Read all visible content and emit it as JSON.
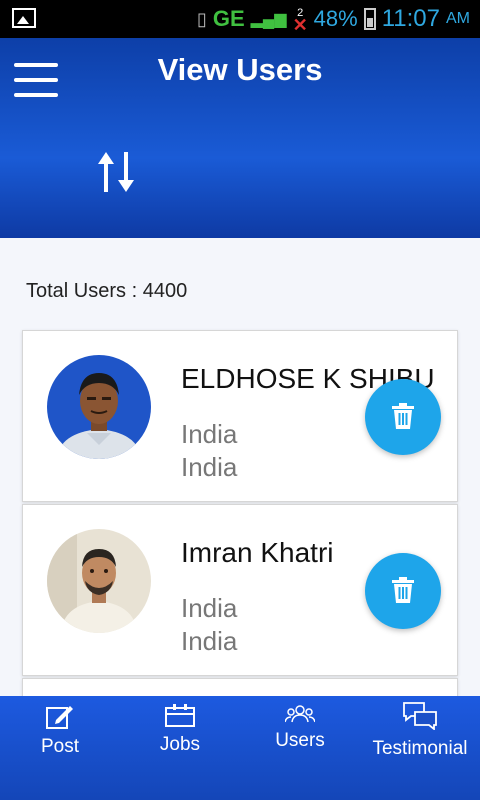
{
  "status": {
    "network": "GE",
    "sim": "2",
    "battery": "48%",
    "time": "11:07",
    "ampm": "AM"
  },
  "header": {
    "title": "View Users"
  },
  "content": {
    "total_label": "Total Users : 4400",
    "users": [
      {
        "name": "ELDHOSE K SHIBU",
        "line1": "India",
        "line2": "India"
      },
      {
        "name": "Imran Khatri",
        "line1": "India",
        "line2": "India"
      }
    ]
  },
  "nav": [
    {
      "label": "Post",
      "icon": "post-icon"
    },
    {
      "label": "Jobs",
      "icon": "jobs-icon"
    },
    {
      "label": "Users",
      "icon": "users-icon"
    },
    {
      "label": "Testimonial",
      "icon": "testimonial-icon"
    }
  ],
  "colors": {
    "primary": "#1a5bd6",
    "accent": "#1ea5ea"
  }
}
